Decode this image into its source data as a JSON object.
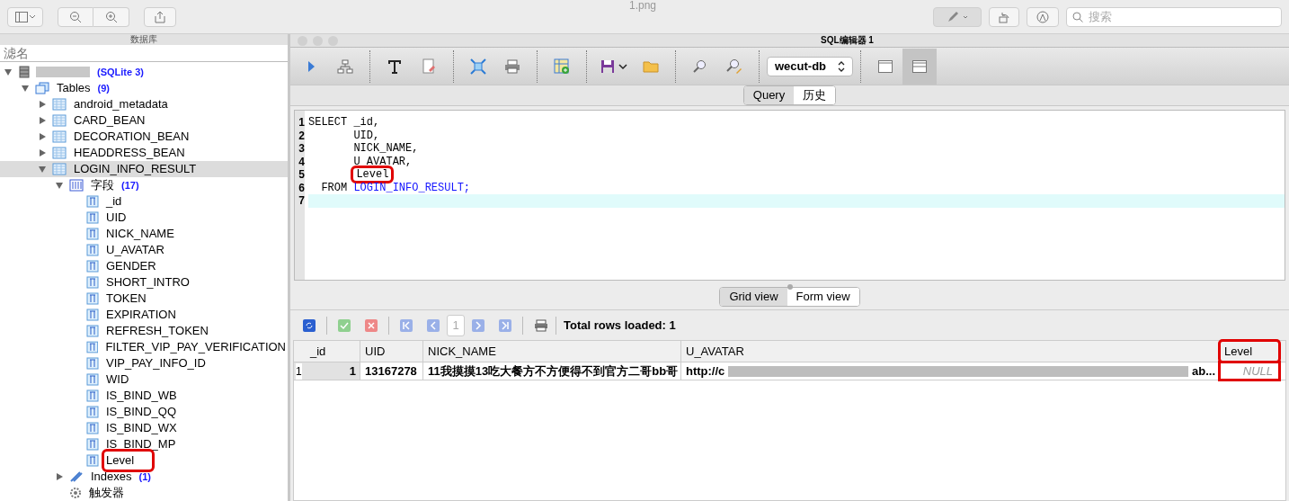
{
  "viewer": {
    "title": "1.png",
    "search": {
      "placeholder": "搜索"
    }
  },
  "db_panel": {
    "title": "数据库",
    "filter": {
      "placeholder": "滤名"
    },
    "tree": [
      {
        "label": "(SQLite 3)",
        "kind": "database",
        "expanded": true,
        "selected": false,
        "children": [
          {
            "label": "Tables",
            "count": "(9)",
            "kind": "group",
            "expanded": true,
            "selected": false,
            "children": [
              {
                "label": "android_metadata",
                "kind": "table",
                "expanded": false,
                "selected": false
              },
              {
                "label": "CARD_BEAN",
                "kind": "table",
                "expanded": false,
                "selected": false
              },
              {
                "label": "DECORATION_BEAN",
                "kind": "table",
                "expanded": false,
                "selected": false
              },
              {
                "label": "HEADDRESS_BEAN",
                "kind": "table",
                "expanded": false,
                "selected": false
              },
              {
                "label": "LOGIN_INFO_RESULT",
                "kind": "table",
                "expanded": true,
                "selected": true,
                "children": [
                  {
                    "label": "字段",
                    "count": "(17)",
                    "kind": "fields",
                    "expanded": true,
                    "selected": false,
                    "children": [
                      {
                        "label": "_id",
                        "kind": "column",
                        "selected": false,
                        "highlighted": false
                      },
                      {
                        "label": "UID",
                        "kind": "column",
                        "selected": false,
                        "highlighted": false
                      },
                      {
                        "label": "NICK_NAME",
                        "kind": "column",
                        "selected": false,
                        "highlighted": false
                      },
                      {
                        "label": "U_AVATAR",
                        "kind": "column",
                        "selected": false,
                        "highlighted": false
                      },
                      {
                        "label": "GENDER",
                        "kind": "column",
                        "selected": false,
                        "highlighted": false
                      },
                      {
                        "label": "SHORT_INTRO",
                        "kind": "column",
                        "selected": false,
                        "highlighted": false
                      },
                      {
                        "label": "TOKEN",
                        "kind": "column",
                        "selected": false,
                        "highlighted": false
                      },
                      {
                        "label": "EXPIRATION",
                        "kind": "column",
                        "selected": false,
                        "highlighted": false
                      },
                      {
                        "label": "REFRESH_TOKEN",
                        "kind": "column",
                        "selected": false,
                        "highlighted": false
                      },
                      {
                        "label": "FILTER_VIP_PAY_VERIFICATION",
                        "kind": "column",
                        "selected": false,
                        "highlighted": false
                      },
                      {
                        "label": "VIP_PAY_INFO_ID",
                        "kind": "column",
                        "selected": false,
                        "highlighted": false
                      },
                      {
                        "label": "WID",
                        "kind": "column",
                        "selected": false,
                        "highlighted": false
                      },
                      {
                        "label": "IS_BIND_WB",
                        "kind": "column",
                        "selected": false,
                        "highlighted": false
                      },
                      {
                        "label": "IS_BIND_QQ",
                        "kind": "column",
                        "selected": false,
                        "highlighted": false
                      },
                      {
                        "label": "IS_BIND_WX",
                        "kind": "column",
                        "selected": false,
                        "highlighted": false
                      },
                      {
                        "label": "IS_BIND_MP",
                        "kind": "column",
                        "selected": false,
                        "highlighted": false
                      },
                      {
                        "label": "Level",
                        "kind": "column",
                        "selected": false,
                        "highlighted": true
                      }
                    ]
                  },
                  {
                    "label": "Indexes",
                    "count": "(1)",
                    "kind": "indexes",
                    "expanded": false,
                    "selected": false
                  },
                  {
                    "label": "触发器",
                    "kind": "triggers",
                    "selected": false
                  }
                ]
              }
            ]
          }
        ]
      }
    ]
  },
  "editor": {
    "title": "SQL编辑器 1",
    "database": "wecut-db",
    "layout_buttons": [
      {
        "selected": false
      },
      {
        "selected": true
      }
    ],
    "tabs": [
      {
        "label": "Query",
        "selected": true
      },
      {
        "label": "历史",
        "selected": false
      }
    ],
    "lines": [
      {
        "number": "1",
        "text": "SELECT _id,",
        "current": false,
        "highlighted": false
      },
      {
        "number": "2",
        "text": "       UID,",
        "current": false,
        "highlighted": false
      },
      {
        "number": "3",
        "text": "       NICK_NAME,",
        "current": false,
        "highlighted": false
      },
      {
        "number": "4",
        "text": "       U_AVATAR,",
        "current": false,
        "highlighted": false
      },
      {
        "number": "5",
        "text": "       Level",
        "current": false,
        "highlighted": true
      },
      {
        "number": "6",
        "text": "  FROM ",
        "table": "LOGIN_INFO_RESULT;",
        "current": false,
        "highlighted": false
      },
      {
        "number": "7",
        "current": true,
        "highlighted": false
      }
    ]
  },
  "results": {
    "tabs": [
      {
        "label": "Grid view",
        "selected": true
      },
      {
        "label": "Form view",
        "selected": false
      }
    ],
    "page": "1",
    "status": "Total rows loaded: 1",
    "columns": [
      {
        "label": "_id",
        "highlighted": false
      },
      {
        "label": "UID",
        "highlighted": false
      },
      {
        "label": "NICK_NAME",
        "highlighted": false
      },
      {
        "label": "U_AVATAR",
        "highlighted": false
      },
      {
        "label": "Level",
        "highlighted": true
      }
    ],
    "rows": [
      {
        "number": "1",
        "cells": [
          {
            "kind": "number",
            "text": "1"
          },
          {
            "kind": "text",
            "text": "13167278"
          },
          {
            "kind": "text",
            "text": "11我摸摸13吃大餐方不方便得不到官方二哥bb哥"
          },
          {
            "kind": "redacted",
            "text": "http://c",
            "tail": "ab..."
          },
          {
            "kind": "null",
            "text": "NULL"
          }
        ]
      }
    ]
  }
}
